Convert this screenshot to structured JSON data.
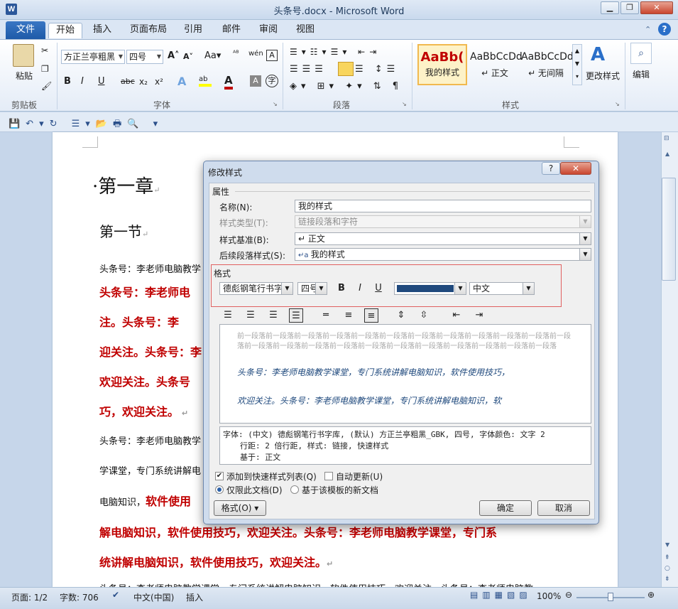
{
  "window": {
    "title": "头条号.docx - Microsoft Word",
    "icon": "W"
  },
  "ribbon": {
    "tabs": [
      "文件",
      "开始",
      "插入",
      "页面布局",
      "引用",
      "邮件",
      "审阅",
      "视图"
    ],
    "clipboard": {
      "paste_label": "粘贴",
      "group_label": "剪贴板"
    },
    "font": {
      "font_name": "方正兰亭粗黑",
      "font_size": "四号",
      "group_label": "字体",
      "buttons": [
        "B",
        "I",
        "U",
        "abc",
        "x₂",
        "x²",
        "A",
        "A"
      ]
    },
    "paragraph": {
      "group_label": "段落"
    },
    "styles": {
      "group_label": "样式",
      "items": [
        {
          "preview": "AaBb(",
          "name": "我的样式"
        },
        {
          "preview": "AaBbCcDd",
          "name": "↵ 正文"
        },
        {
          "preview": "AaBbCcDd",
          "name": "↵ 无间隔"
        }
      ],
      "change_styles": "更改样式",
      "edit": "编辑"
    }
  },
  "document": {
    "heading1": "·第一章",
    "heading2": "第一节",
    "lines": [
      {
        "text": "头条号：李老师电脑教学",
        "style": "normal"
      },
      {
        "text": "头条号：李老师电",
        "style": "red"
      },
      {
        "text": "注。头条号：李",
        "style": "red"
      },
      {
        "text": "迎关注。头条号：李",
        "style": "red"
      },
      {
        "text": "欢迎关注。头条号",
        "style": "red"
      },
      {
        "text": "巧，欢迎关注。",
        "style": "red"
      },
      {
        "text": "头条号：李老师电脑教学",
        "style": "normal"
      },
      {
        "text": "学课堂，专门系统讲解电",
        "style": "normal"
      },
      {
        "text": "电脑知识，",
        "style": "normal"
      },
      {
        "text": "软件使用",
        "style": "red"
      },
      {
        "text": "解电脑知识，软件使用技巧，欢迎关注。头条号：李老师电脑教学课堂，专门系",
        "style": "red"
      },
      {
        "text": "统讲解电脑知识，软件使用技巧，欢迎关注。",
        "style": "red"
      },
      {
        "text": "头条号：李老师电脑教学课堂，专门系统讲解电脑知识，软件使用技巧，欢迎关注。头条号：李老师电脑教",
        "style": "normal"
      }
    ]
  },
  "dialog": {
    "title": "修改样式",
    "help": "?",
    "close": "✕",
    "properties_label": "属性",
    "name_label": "名称(N):",
    "name_value": "我的样式",
    "type_label": "样式类型(T):",
    "type_value": "链接段落和字符",
    "base_label": "样式基准(B):",
    "base_value": "↵ 正文",
    "next_label": "后续段落样式(S):",
    "next_value": "我的样式",
    "format_label": "格式",
    "font_value": "德彪钢笔行书字",
    "size_value": "四号",
    "bold": "B",
    "italic": "I",
    "underline": "U",
    "script_value": "中文",
    "font_color": "#1f497d",
    "preview_prev": "前一段落前一段落前一段落前一段落前一段落前一段落前一段落前一段落前一段落前一段落前一段落前一段落前一段落前一段落前一段落前一段落前一段落前一段落前一段落前一段落前一段落前一段落前一段落",
    "preview_line1": "头条号：李老师电脑教学课堂，专门系统讲解电脑知识，软件使用技巧，",
    "preview_line2": "欢迎关注。头条号：李老师电脑教学课堂，专门系统讲解电脑知识，软",
    "description_line1": "字体: (中文) 德彪钢笔行书字库, (默认) 方正兰亭粗黑_GBK, 四号, 字体颜色: 文字 2",
    "description_line2": "行距: 2 倍行距, 样式: 链接, 快速样式",
    "description_line3": "基于: 正文",
    "add_quick_style": "添加到快速样式列表(Q)",
    "auto_update": "自动更新(U)",
    "only_this_doc": "仅限此文档(D)",
    "new_docs_template": "基于该模板的新文档",
    "format_button": "格式(O) ▾",
    "ok": "确定",
    "cancel": "取消"
  },
  "statusbar": {
    "page": "页面: 1/2",
    "words": "字数: 706",
    "language": "中文(中国)",
    "mode": "插入",
    "zoom": "100%"
  }
}
